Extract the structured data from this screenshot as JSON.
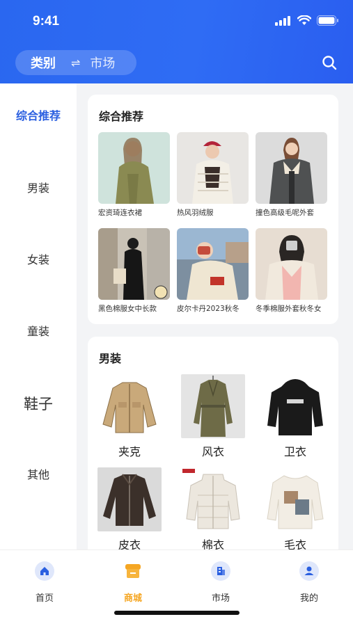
{
  "status": {
    "time": "9:41"
  },
  "header": {
    "category_label": "类别",
    "swap_symbol": "⇌",
    "market_label": "市场",
    "search_icon": "search-icon"
  },
  "sidebar": {
    "items": [
      {
        "label": "综合推荐",
        "active": true
      },
      {
        "label": "男装"
      },
      {
        "label": "女装"
      },
      {
        "label": "童装"
      },
      {
        "label": "鞋子"
      },
      {
        "label": "其他"
      }
    ]
  },
  "recommend": {
    "title": "综合推荐",
    "items": [
      {
        "caption": "宏资琦连衣裙"
      },
      {
        "caption": "热风羽绒服"
      },
      {
        "caption": "撞色高级毛呢外套"
      },
      {
        "caption": "黑色棉服女中长款"
      },
      {
        "caption": "皮尔卡丹2023秋冬"
      },
      {
        "caption": "冬季棉服外套秋冬女"
      }
    ]
  },
  "menswear": {
    "title": "男装",
    "items": [
      {
        "label": "夹克"
      },
      {
        "label": "风衣"
      },
      {
        "label": "卫衣"
      },
      {
        "label": "皮衣"
      },
      {
        "label": "棉衣"
      },
      {
        "label": "毛衣"
      }
    ]
  },
  "tabbar": {
    "items": [
      {
        "label": "首页",
        "icon": "home-icon"
      },
      {
        "label": "商城",
        "icon": "shop-icon",
        "active": true
      },
      {
        "label": "市场",
        "icon": "building-icon"
      },
      {
        "label": "我的",
        "icon": "user-icon"
      }
    ]
  },
  "colors": {
    "primary": "#2a5fe0",
    "accent": "#f5a623"
  }
}
